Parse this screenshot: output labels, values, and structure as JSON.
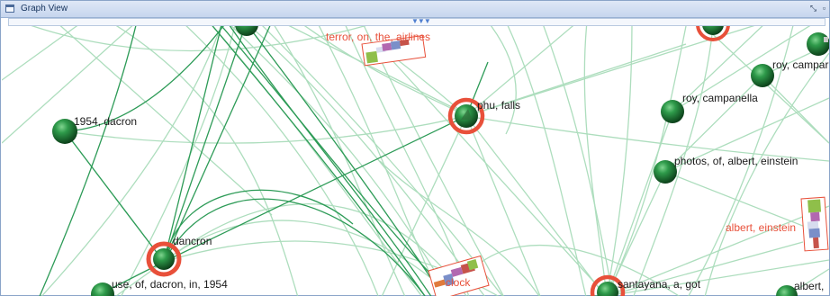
{
  "window": {
    "title": "Graph View",
    "icon": "panel-icon",
    "buttons": [
      "restore-icon",
      "maximize-icon"
    ]
  },
  "colors": {
    "edge_light": "#9fd8b2",
    "edge_dark": "#2d9b57",
    "node": "#1f7a37",
    "highlight": "#e8503a"
  },
  "graph": {
    "nodes": [
      {
        "id": "top-left-node",
        "label": ""
      },
      {
        "id": "terror",
        "label": "terror, on, the, airlines",
        "highlight": true
      },
      {
        "id": "top-right-node",
        "label": ""
      },
      {
        "id": "roy-campanella-2",
        "label": "roy, campar"
      },
      {
        "id": "1954-dacron",
        "label": "1954, dacron"
      },
      {
        "id": "phu-falls",
        "label": "phu, falls",
        "highlight": true
      },
      {
        "id": "roy-campanella",
        "label": "roy, campanella"
      },
      {
        "id": "photos-einstein",
        "label": "photos, of, albert, einstein"
      },
      {
        "id": "albert-einstein",
        "label": "albert, einstein",
        "highlight": true
      },
      {
        "id": "dancron",
        "label": "dancron",
        "highlight": true
      },
      {
        "id": "clock",
        "label": "clock",
        "highlight": true
      },
      {
        "id": "use-dacron",
        "label": "use, of, dacron, in, 1954"
      },
      {
        "id": "santayana",
        "label": "santayana, a, got",
        "highlight": true
      },
      {
        "id": "albert-right",
        "label": "albert,"
      }
    ]
  }
}
